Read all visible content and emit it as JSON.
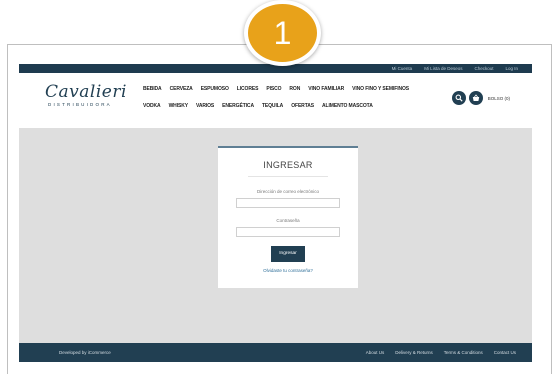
{
  "badge": {
    "number": "1"
  },
  "topbar": {
    "links": [
      "Mi Cuenta",
      "Mi Lista de Deseos",
      "Checkout",
      "Log In"
    ]
  },
  "logo": {
    "name": "Cavalieri",
    "tagline": "DISTRIBUIDORA"
  },
  "nav": {
    "row1": [
      "BEBIDA",
      "CERVEZA",
      "ESPUMOSO",
      "LICORES",
      "PISCO",
      "RON",
      "VINO FAMILIAR",
      "VINO FINO Y SEMIFINOS"
    ],
    "row2": [
      "VODKA",
      "WHISKY",
      "VARIOS",
      "ENERGÉTICA",
      "TEQUILA",
      "OFERTAS",
      "ALIMENTO MASCOTA"
    ]
  },
  "cart": {
    "label": "BOLSO (0)"
  },
  "login": {
    "title": "INGRESAR",
    "email_label": "Dirección de correo electrónico",
    "password_label": "Contraseña",
    "submit": "Ingresar",
    "forgot": "Olvidaste tu contraseña?"
  },
  "footer": {
    "credit": "Developed by iCommerce",
    "links": [
      "About Us",
      "Delivery & Returns",
      "Terms & Conditions",
      "Contact Us"
    ]
  },
  "colors": {
    "navy": "#213f52",
    "badge": "#e8a21a",
    "background": "#dedede"
  }
}
